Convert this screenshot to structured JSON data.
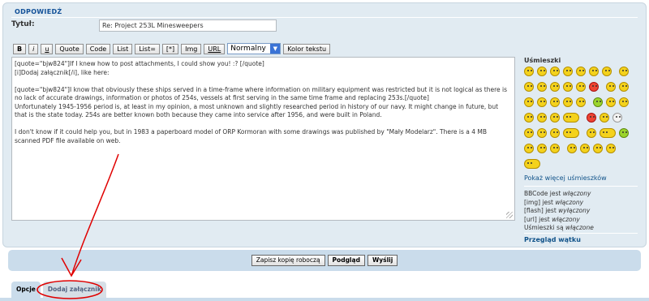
{
  "panel": {
    "title": "ODPOWIEDŹ"
  },
  "subject": {
    "label": "Tytuł:",
    "value": "Re: Project 253L Minesweepers"
  },
  "toolbar": {
    "bold": "B",
    "italic": "i",
    "underline": "u",
    "quote": "Quote",
    "code": "Code",
    "list": "List",
    "list_ordered": "List=",
    "list_item": "[*]",
    "img": "Img",
    "url": "URL",
    "font_size": "Normalny",
    "font_color": "Kolor tekstu"
  },
  "message": {
    "lines": [
      "[quote=\"bjw824\"]If I knew how to post attachments, I could show you! :? [/quote]\n[i]Dodaj załącznik[/i], like here:",
      "[quote=\"bjw824\"]I know that obviously these ships served in a time-frame where information on military equipment was restricted but it is not logical as there is no lack of accurate drawings, information or photos of 254s, vessels at first serving in the same time frame and replacing 253s.[/quote]\nUnfortunately 1945-1956 period is, at least in my opinion, a most unknown and slightly researched period in history of our navy. It might change in future, but that is the state today. 254s are better known both because they came into service after 1956, and were built in Poland.",
      "I don't know if it could help you, but in 1983 a paperboard model of ORP Kormoran with some drawings was published by \"Mały Modelarz\". There is a 4 MB scanned PDF file available on web."
    ]
  },
  "smilies": {
    "title": "Uśmieszki",
    "more": "Pokaż więcej uśmieszków"
  },
  "status": {
    "bbcode": {
      "prefix": "BBCode jest ",
      "state": "włączony"
    },
    "img": {
      "prefix": "[img] jest ",
      "state": "włączony"
    },
    "flash": {
      "prefix": "[flash] jest ",
      "state": "wyłączony"
    },
    "url": {
      "prefix": "[url] jest ",
      "state": "włączony"
    },
    "smilies": {
      "prefix": "Uśmieszki są ",
      "state": "włączone"
    }
  },
  "review": {
    "label": "Przegląd wątku"
  },
  "submit": {
    "save_draft": "Zapisz kopię roboczą",
    "preview": "Podgląd",
    "send": "Wyślij"
  },
  "tabs": {
    "options": "Opcje",
    "attachments": "Dodaj załącznik"
  },
  "colors": {
    "panel_bg": "#e1ebf2",
    "link": "#105289",
    "annotation": "#e00000"
  }
}
